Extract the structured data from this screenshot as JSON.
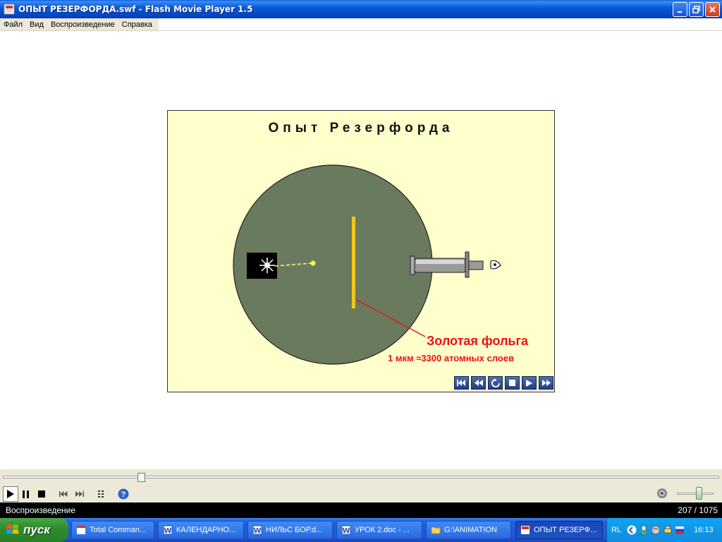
{
  "window": {
    "title": "ОПЫТ РЕЗЕРФОРДА.swf - Flash Movie Player 1.5"
  },
  "menu": {
    "items": [
      "Файл",
      "Вид",
      "Воспроизведение",
      "Справка"
    ]
  },
  "stage": {
    "title": "Опыт Резерфорда",
    "foil_label": "Золотая фольга",
    "foil_caption": "1 мкм ≈3300 атомных слоев",
    "controls": [
      "rewind-start-icon",
      "step-back-icon",
      "replay-icon",
      "stop-icon",
      "play-icon",
      "step-forward-icon"
    ]
  },
  "player": {
    "seek_position": 0.193,
    "volume_level": 0.6,
    "status_text": "Воспроизведение",
    "frame_counter": "207 / 1075"
  },
  "taskbar": {
    "start_label": "пуск",
    "tasks": [
      {
        "label": "Total Comman...",
        "icon": "window-icon"
      },
      {
        "label": "КАЛЕНДАРНО...",
        "icon": "word-doc-icon"
      },
      {
        "label": "НИЛЬС БОР.d...",
        "icon": "word-doc-icon"
      },
      {
        "label": "УРОК 2.doc - ...",
        "icon": "word-doc-icon"
      },
      {
        "label": "G:\\ANIMATION",
        "icon": "folder-icon"
      },
      {
        "label": "ОПЫТ РЕЗЕРФ...",
        "icon": "flash-player-icon",
        "active": true
      }
    ],
    "tray": {
      "language": "RL",
      "clock": "16:13"
    }
  }
}
